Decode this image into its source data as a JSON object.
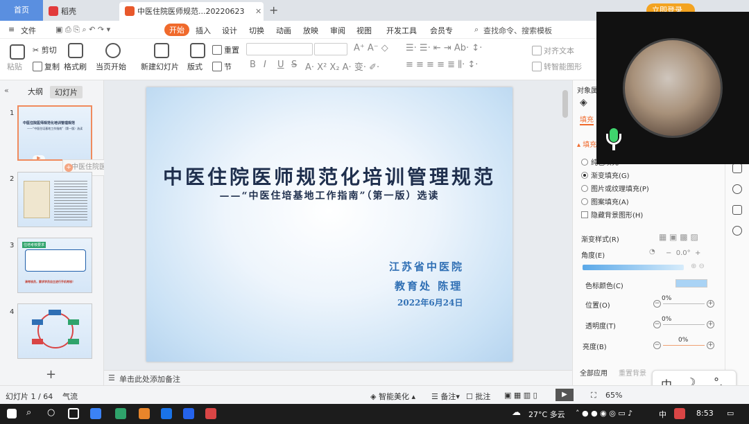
{
  "tabs": {
    "home": "首页",
    "daoke": "稻壳",
    "doc": "中医住院医师规范...20220623",
    "new_tab": "+"
  },
  "login": "立即登录",
  "menu": {
    "file": "文件",
    "items": [
      "开始",
      "插入",
      "设计",
      "切换",
      "动画",
      "放映",
      "审阅",
      "视图",
      "开发工具",
      "会员专"
    ],
    "search": "查找命令、搜索模板"
  },
  "ribbon": {
    "cut": "剪切",
    "paste": "粘贴",
    "copy": "复制",
    "format_painter": "格式刷",
    "from_start": "当页开始",
    "new_slide": "新建幻灯片",
    "layout": "版式",
    "section": "节",
    "reset": "重置",
    "align_text": "对齐文本",
    "smart_graphic": "转智能图形",
    "bold": "B",
    "italic": "I",
    "underline": "U",
    "strike": "S"
  },
  "left_pane": {
    "outline_tab": "大纲",
    "slides_tab": "幻灯片",
    "slide_numbers": [
      "1",
      "2",
      "3",
      "4"
    ],
    "tooltip": "中医住院医师规范化培...",
    "add": "+"
  },
  "slide": {
    "title": "中医住院医师规范化培训管理规范",
    "subtitle": "——“中医住培基地工作指南”（第一版）选读",
    "org": "江苏省中医院",
    "dept": "教育处  陈理",
    "date": "2022年6月24日"
  },
  "thumb_text": {
    "t1_title": "中医住院医师规范化培训管理规范",
    "t1_sub": "——“中医住培基地工作指南”（第一版）选读",
    "t3_head": "住培考核要求",
    "t3_foot": "请考核员，要求学员自主进行手机考核！"
  },
  "notes": "单击此处添加备注",
  "right_pane": {
    "header": "对象属",
    "fill_tab": "填充",
    "fill_section": "填充",
    "options": [
      "纯色填充",
      "渐变填充(G)",
      "图片或纹理填充(P)",
      "图案填充(A)"
    ],
    "hide_bg": "隐藏背景图形(H)",
    "gradient_style": "渐变样式(R)",
    "angle": "角度(E)",
    "angle_value": "0.0°",
    "stop_color": "色标颜色(C)",
    "position": "位置(O)",
    "transparency": "透明度(T)",
    "brightness": "亮度(B)",
    "pct": "0%",
    "apply_all": "全部应用",
    "reset_bg": "重置背景"
  },
  "ime": {
    "zh": "中",
    "moon": "☽",
    "punct": "°,"
  },
  "status": {
    "slide_count": "幻灯片 1 / 64",
    "theme": "气流",
    "beautify": "智能美化",
    "notes": "备注",
    "comment": "批注",
    "zoom": "65%"
  },
  "taskbar": {
    "weather": "27°C 多云",
    "lang": "中",
    "time": "8:53"
  },
  "colors": {
    "accent": "#f06a2c",
    "slide_title": "#1f2f4d",
    "slide_org": "#2f6fb4",
    "taskbar": "#1c1c1c"
  }
}
